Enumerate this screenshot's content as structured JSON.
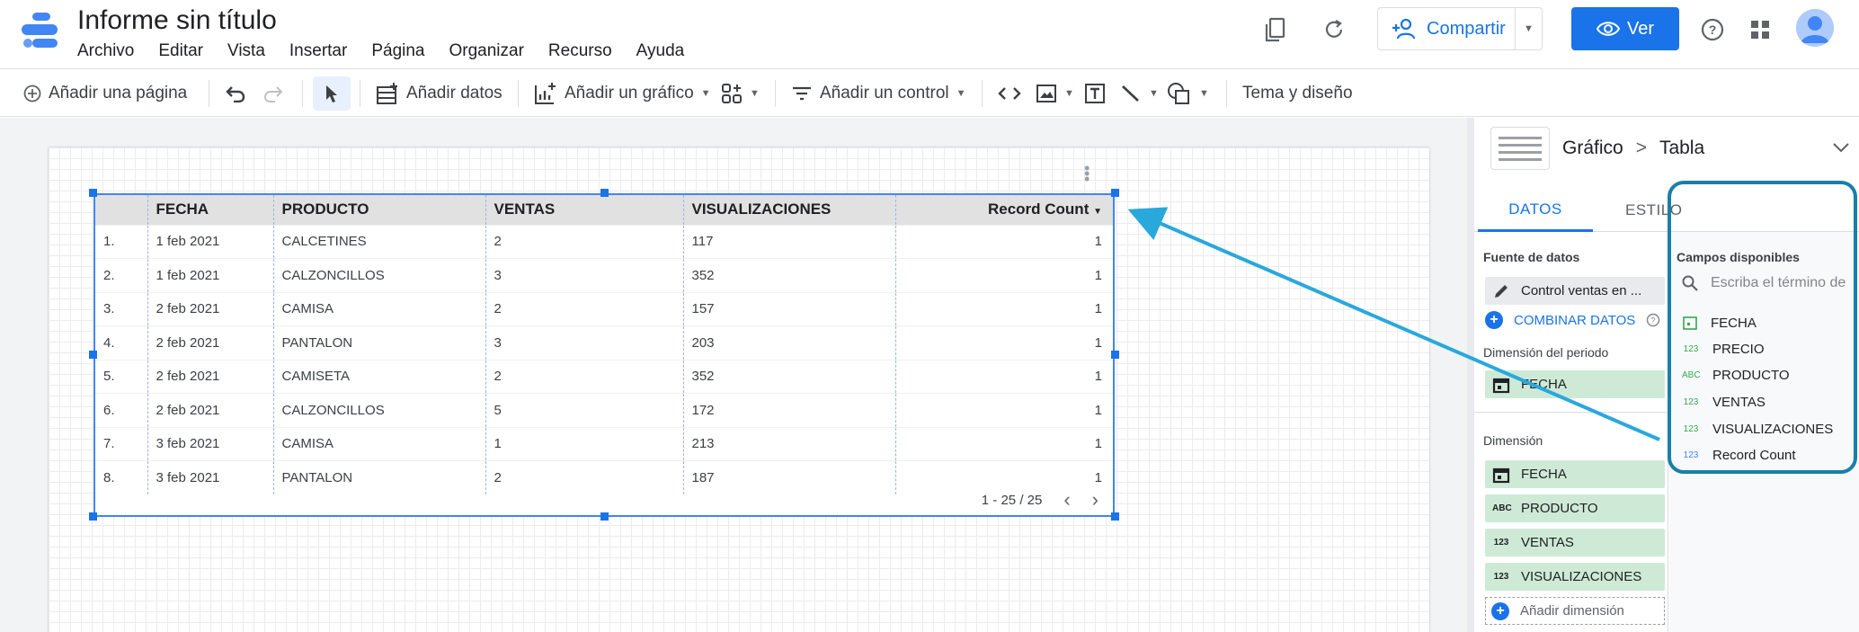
{
  "app": {
    "title": "Informe sin título",
    "menu": [
      "Archivo",
      "Editar",
      "Vista",
      "Insertar",
      "Página",
      "Organizar",
      "Recurso",
      "Ayuda"
    ],
    "share_label": "Compartir",
    "view_label": "Ver"
  },
  "toolbar": {
    "add_page": "Añadir una página",
    "add_data": "Añadir datos",
    "add_chart": "Añadir un gráfico",
    "add_control": "Añadir un control",
    "theme": "Tema y diseño"
  },
  "table": {
    "columns": [
      "",
      "FECHA",
      "PRODUCTO",
      "VENTAS",
      "VISUALIZACIONES",
      "Record Count"
    ],
    "rows": [
      [
        "1.",
        "1 feb 2021",
        "CALCETINES",
        "2",
        "117",
        "1"
      ],
      [
        "2.",
        "1 feb 2021",
        "CALZONCILLOS",
        "3",
        "352",
        "1"
      ],
      [
        "3.",
        "2 feb 2021",
        "CAMISA",
        "2",
        "157",
        "1"
      ],
      [
        "4.",
        "2 feb 2021",
        "PANTALON",
        "3",
        "203",
        "1"
      ],
      [
        "5.",
        "2 feb 2021",
        "CAMISETA",
        "2",
        "352",
        "1"
      ],
      [
        "6.",
        "2 feb 2021",
        "CALZONCILLOS",
        "5",
        "172",
        "1"
      ],
      [
        "7.",
        "3 feb 2021",
        "CAMISA",
        "1",
        "213",
        "1"
      ],
      [
        "8.",
        "3 feb 2021",
        "PANTALON",
        "2",
        "187",
        "1"
      ]
    ],
    "pagination": "1 - 25 / 25"
  },
  "panel": {
    "breadcrumb_parent": "Gráfico",
    "breadcrumb_sep": ">",
    "breadcrumb_current": "Tabla",
    "tab_data": "DATOS",
    "tab_style": "ESTILO",
    "source_label": "Fuente de datos",
    "source_value": "Control ventas en ...",
    "blend_label": "COMBINAR DATOS",
    "period_label": "Dimensión del periodo",
    "period_value": "FECHA",
    "dimension_label": "Dimensión",
    "dimensions": [
      {
        "type": "date",
        "name": "FECHA"
      },
      {
        "type": "ABC",
        "name": "PRODUCTO"
      },
      {
        "type": "123",
        "name": "VENTAS"
      },
      {
        "type": "123",
        "name": "VISUALIZACIONES"
      }
    ],
    "add_dimension": "Añadir dimensión",
    "available_label": "Campos disponibles",
    "search_placeholder": "Escriba el término de",
    "fields": [
      {
        "type": "date",
        "name": "FECHA"
      },
      {
        "type": "123",
        "name": "PRECIO"
      },
      {
        "type": "ABC",
        "name": "PRODUCTO"
      },
      {
        "type": "123",
        "name": "VENTAS"
      },
      {
        "type": "123",
        "name": "VISUALIZACIONES"
      },
      {
        "type": "123",
        "name": "Record Count"
      }
    ]
  },
  "colors": {
    "accent": "#1a73e8",
    "dimension_chip": "#ceead6",
    "annotation_arrow": "#29a8dc",
    "annotation_frame": "#1a7fa8"
  }
}
